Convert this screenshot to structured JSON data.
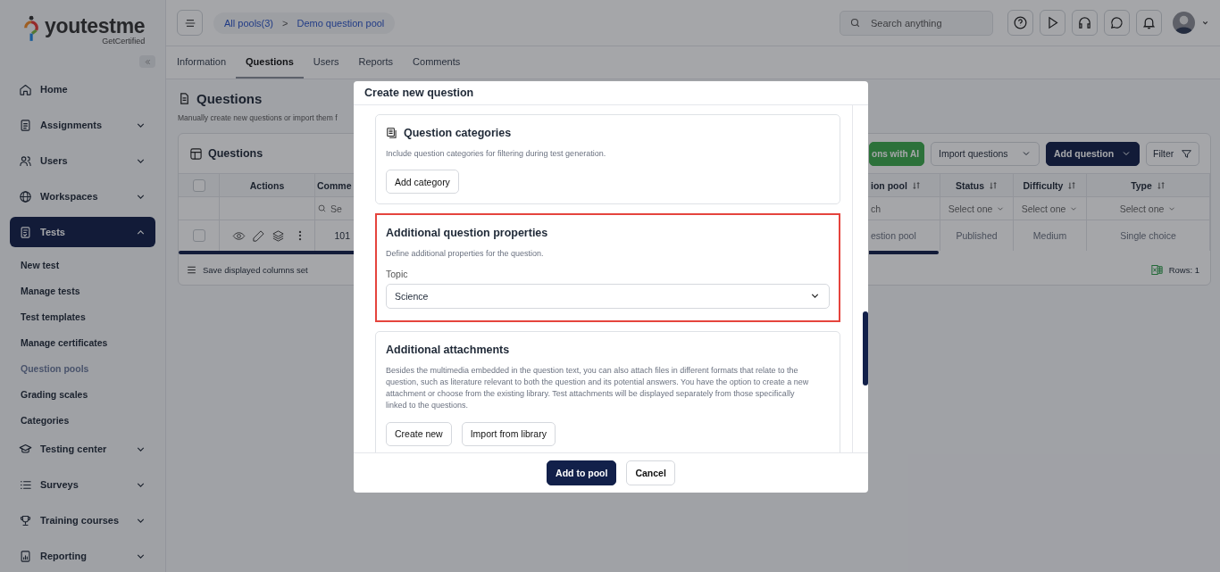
{
  "logo": {
    "name": "youtestme",
    "tagline": "GetCertified"
  },
  "sidebar": {
    "items": [
      {
        "label": "Home",
        "selected": false
      },
      {
        "label": "Assignments",
        "selected": false,
        "expanded": false
      },
      {
        "label": "Users",
        "selected": false,
        "expanded": false
      },
      {
        "label": "Workspaces",
        "selected": false,
        "expanded": false
      },
      {
        "label": "Tests",
        "selected": true,
        "expanded": true,
        "children": [
          {
            "label": "New test",
            "selected": false
          },
          {
            "label": "Manage tests",
            "selected": false
          },
          {
            "label": "Test templates",
            "selected": false
          },
          {
            "label": "Manage certificates",
            "selected": false
          },
          {
            "label": "Question pools",
            "selected": true
          },
          {
            "label": "Grading scales",
            "selected": false
          },
          {
            "label": "Categories",
            "selected": false
          }
        ]
      },
      {
        "label": "Testing center",
        "selected": false,
        "expanded": false
      },
      {
        "label": "Surveys",
        "selected": false,
        "expanded": false
      },
      {
        "label": "Training courses",
        "selected": false,
        "expanded": false
      },
      {
        "label": "Reporting",
        "selected": false,
        "expanded": false
      }
    ]
  },
  "breadcrumb": {
    "items": [
      "All pools(3)",
      "Demo question pool"
    ],
    "separator": ">"
  },
  "search": {
    "placeholder": "Search anything"
  },
  "tabs": [
    {
      "label": "Information",
      "selected": false
    },
    {
      "label": "Questions",
      "selected": true
    },
    {
      "label": "Users",
      "selected": false
    },
    {
      "label": "Reports",
      "selected": false
    },
    {
      "label": "Comments",
      "selected": false
    }
  ],
  "page": {
    "title": "Questions",
    "description": "Manually create new questions or import them f"
  },
  "questions_card": {
    "title": "Questions",
    "buttons": [
      {
        "label": "ons with AI",
        "kind": "success"
      },
      {
        "label": "Import questions",
        "kind": "dropdown"
      },
      {
        "label": "Add question",
        "kind": "primary"
      },
      {
        "label": "Filter",
        "kind": "filter"
      }
    ],
    "table": {
      "select_all_checked": false,
      "columns": [
        {
          "label": "Actions",
          "sortable": false
        },
        {
          "label": "Comme"
        },
        {
          "label": "ion pool",
          "sortable": true
        },
        {
          "label": "Status",
          "sortable": true
        },
        {
          "label": "Difficulty",
          "sortable": true
        },
        {
          "label": "Type",
          "sortable": true
        }
      ],
      "filters": [
        {
          "kind": "empty"
        },
        {
          "kind": "search",
          "text": "Se"
        },
        {
          "kind": "text",
          "text": "ch"
        },
        {
          "kind": "select",
          "text": "Select one"
        },
        {
          "kind": "select",
          "text": "Select one"
        },
        {
          "kind": "select",
          "text": "Select one"
        }
      ],
      "rows": [
        {
          "checked": false,
          "cells": [
            "",
            "101",
            "estion pool",
            "Published",
            "Medium",
            "Single choice"
          ]
        }
      ]
    },
    "footer": {
      "save_columns": "Save displayed columns set",
      "rows_count": "Rows: 1"
    }
  },
  "modal": {
    "title": "Create new question",
    "sections": [
      {
        "title": "Question categories",
        "kind": "buttons",
        "highlighted": false,
        "description": "Include question categories for filtering during test generation.",
        "buttons": [
          "Add category"
        ]
      },
      {
        "title": "Additional question properties",
        "kind": "field",
        "highlighted": true,
        "description": "Define additional properties for the question.",
        "field": {
          "label": "Topic",
          "value": "Science"
        }
      },
      {
        "title": "Additional attachments",
        "kind": "buttons",
        "highlighted": false,
        "description": "Besides the multimedia embedded in the question text, you can also attach files in different formats that relate to the question, such as literature relevant to both the question and its potential answers. You have the option to create a new attachment or choose from the existing library. Test attachments will be displayed separately from those specifically linked to the questions.",
        "buttons": [
          "Create new",
          "Import from library"
        ]
      }
    ],
    "buttons": [
      {
        "label": "Add to pool",
        "kind": "primary"
      },
      {
        "label": "Cancel",
        "kind": "secondary"
      }
    ]
  }
}
